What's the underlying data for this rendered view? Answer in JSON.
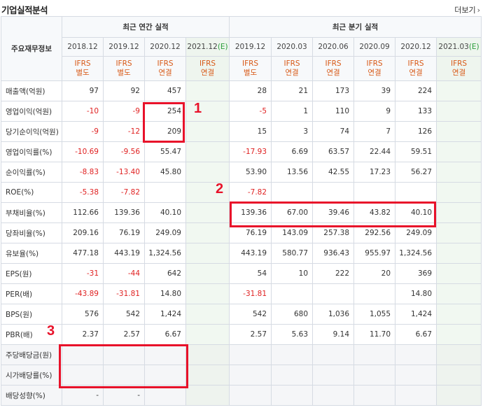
{
  "title": "기업실적분석",
  "more_label": "더보기",
  "header": {
    "main_label": "주요재무정보",
    "annual_group": "최근 연간 실적",
    "quarter_group": "최근 분기 실적",
    "annual_dates": [
      "2018.12",
      "2019.12",
      "2020.12",
      "2021.12"
    ],
    "annual_est_tag": "(E)",
    "quarter_dates": [
      "2019.12",
      "2020.03",
      "2020.06",
      "2020.09",
      "2020.12",
      "2021.03"
    ],
    "quarter_est_tag": "(E)",
    "annual_std": [
      [
        "IFRS",
        "별도"
      ],
      [
        "IFRS",
        "별도"
      ],
      [
        "IFRS",
        "연결"
      ],
      [
        "IFRS",
        "연결"
      ]
    ],
    "quarter_std": [
      [
        "IFRS",
        "별도"
      ],
      [
        "IFRS",
        "연결"
      ],
      [
        "IFRS",
        "연결"
      ],
      [
        "IFRS",
        "연결"
      ],
      [
        "IFRS",
        "연결"
      ],
      [
        "IFRS",
        "연결"
      ]
    ]
  },
  "rows": [
    {
      "label": "매출액(억원)",
      "annual": [
        "97",
        "92",
        "457",
        ""
      ],
      "quarter": [
        "28",
        "21",
        "173",
        "39",
        "224",
        ""
      ]
    },
    {
      "label": "영업이익(억원)",
      "annual": [
        "-10",
        "-9",
        "254",
        ""
      ],
      "quarter": [
        "-5",
        "1",
        "110",
        "9",
        "133",
        ""
      ]
    },
    {
      "label": "당기순이익(억원)",
      "annual": [
        "-9",
        "-12",
        "209",
        ""
      ],
      "quarter": [
        "15",
        "3",
        "74",
        "7",
        "126",
        ""
      ]
    },
    {
      "label": "영업이익률(%)",
      "annual": [
        "-10.69",
        "-9.56",
        "55.47",
        ""
      ],
      "quarter": [
        "-17.93",
        "6.69",
        "63.57",
        "22.44",
        "59.51",
        ""
      ]
    },
    {
      "label": "순이익률(%)",
      "annual": [
        "-8.83",
        "-13.40",
        "45.80",
        ""
      ],
      "quarter": [
        "53.90",
        "13.56",
        "42.55",
        "17.23",
        "56.27",
        ""
      ]
    },
    {
      "label": "ROE(%)",
      "annual": [
        "-5.38",
        "-7.82",
        "",
        ""
      ],
      "quarter": [
        "-7.82",
        "",
        "",
        "",
        "",
        ""
      ]
    },
    {
      "label": "부채비율(%)",
      "annual": [
        "112.66",
        "139.36",
        "40.10",
        ""
      ],
      "quarter": [
        "139.36",
        "67.00",
        "39.46",
        "43.82",
        "40.10",
        ""
      ]
    },
    {
      "label": "당좌비율(%)",
      "annual": [
        "209.16",
        "76.19",
        "249.09",
        ""
      ],
      "quarter": [
        "76.19",
        "143.09",
        "257.38",
        "292.56",
        "249.09",
        ""
      ]
    },
    {
      "label": "유보율(%)",
      "annual": [
        "477.18",
        "443.19",
        "1,324.56",
        ""
      ],
      "quarter": [
        "443.19",
        "580.77",
        "936.43",
        "955.97",
        "1,324.56",
        ""
      ]
    },
    {
      "label": "EPS(원)",
      "annual": [
        "-31",
        "-44",
        "642",
        ""
      ],
      "quarter": [
        "54",
        "10",
        "222",
        "20",
        "369",
        ""
      ]
    },
    {
      "label": "PER(배)",
      "annual": [
        "-43.89",
        "-31.81",
        "14.80",
        ""
      ],
      "quarter": [
        "-31.81",
        "",
        "",
        "",
        "14.80",
        ""
      ]
    },
    {
      "label": "BPS(원)",
      "annual": [
        "576",
        "542",
        "1,424",
        ""
      ],
      "quarter": [
        "542",
        "680",
        "1,036",
        "1,055",
        "1,424",
        ""
      ]
    },
    {
      "label": "PBR(배)",
      "annual": [
        "2.37",
        "2.57",
        "6.67",
        ""
      ],
      "quarter": [
        "2.57",
        "5.63",
        "9.14",
        "11.70",
        "6.67",
        ""
      ]
    },
    {
      "label": "주당배당금(원)",
      "annual": [
        "",
        "",
        "",
        ""
      ],
      "quarter": [
        "",
        "",
        "",
        "",
        "",
        ""
      ]
    },
    {
      "label": "시가배당률(%)",
      "annual": [
        "",
        "",
        "",
        ""
      ],
      "quarter": [
        "",
        "",
        "",
        "",
        "",
        ""
      ]
    },
    {
      "label": "배당성향(%)",
      "annual": [
        "-",
        "-",
        "",
        ""
      ],
      "quarter": [
        "",
        "",
        "",
        "",
        "",
        ""
      ]
    }
  ],
  "annotations": [
    "1",
    "2",
    "3"
  ],
  "colors": {
    "negative": "#e02222",
    "standard": "#d85a18",
    "estimate_tag": "#2a9d3a",
    "highlight": "#e8122a"
  }
}
